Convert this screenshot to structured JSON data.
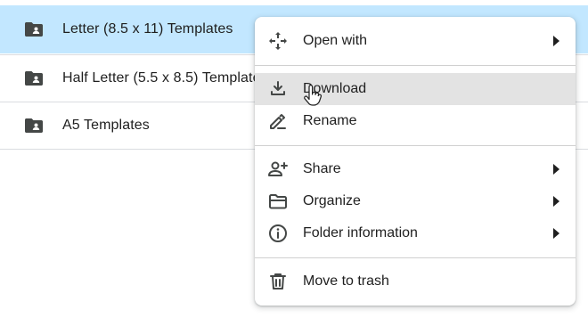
{
  "files": [
    {
      "name": "Letter (8.5 x 11) Templates",
      "icon": "shared-folder-icon",
      "selected": true
    },
    {
      "name": "Half Letter (5.5 x 8.5) Templates",
      "icon": "shared-folder-icon",
      "selected": false
    },
    {
      "name": "A5 Templates",
      "icon": "shared-folder-icon",
      "selected": false
    }
  ],
  "context_menu": {
    "items": [
      {
        "label": "Open with",
        "icon": "move-arrows-icon",
        "has_submenu": true
      },
      {
        "label": "Download",
        "icon": "download-icon",
        "has_submenu": false,
        "hovered": true
      },
      {
        "label": "Rename",
        "icon": "rename-pencil-icon",
        "has_submenu": false
      },
      {
        "label": "Share",
        "icon": "share-person-add-icon",
        "has_submenu": true
      },
      {
        "label": "Organize",
        "icon": "folder-open-icon",
        "has_submenu": true
      },
      {
        "label": "Folder information",
        "icon": "info-icon",
        "has_submenu": true
      },
      {
        "label": "Move to trash",
        "icon": "trash-icon",
        "has_submenu": false
      }
    ]
  },
  "colors": {
    "selected_row": "#c2e7ff",
    "hover_item": "#e3e3e3",
    "text": "#1f1f1f",
    "icon": "#444746"
  }
}
